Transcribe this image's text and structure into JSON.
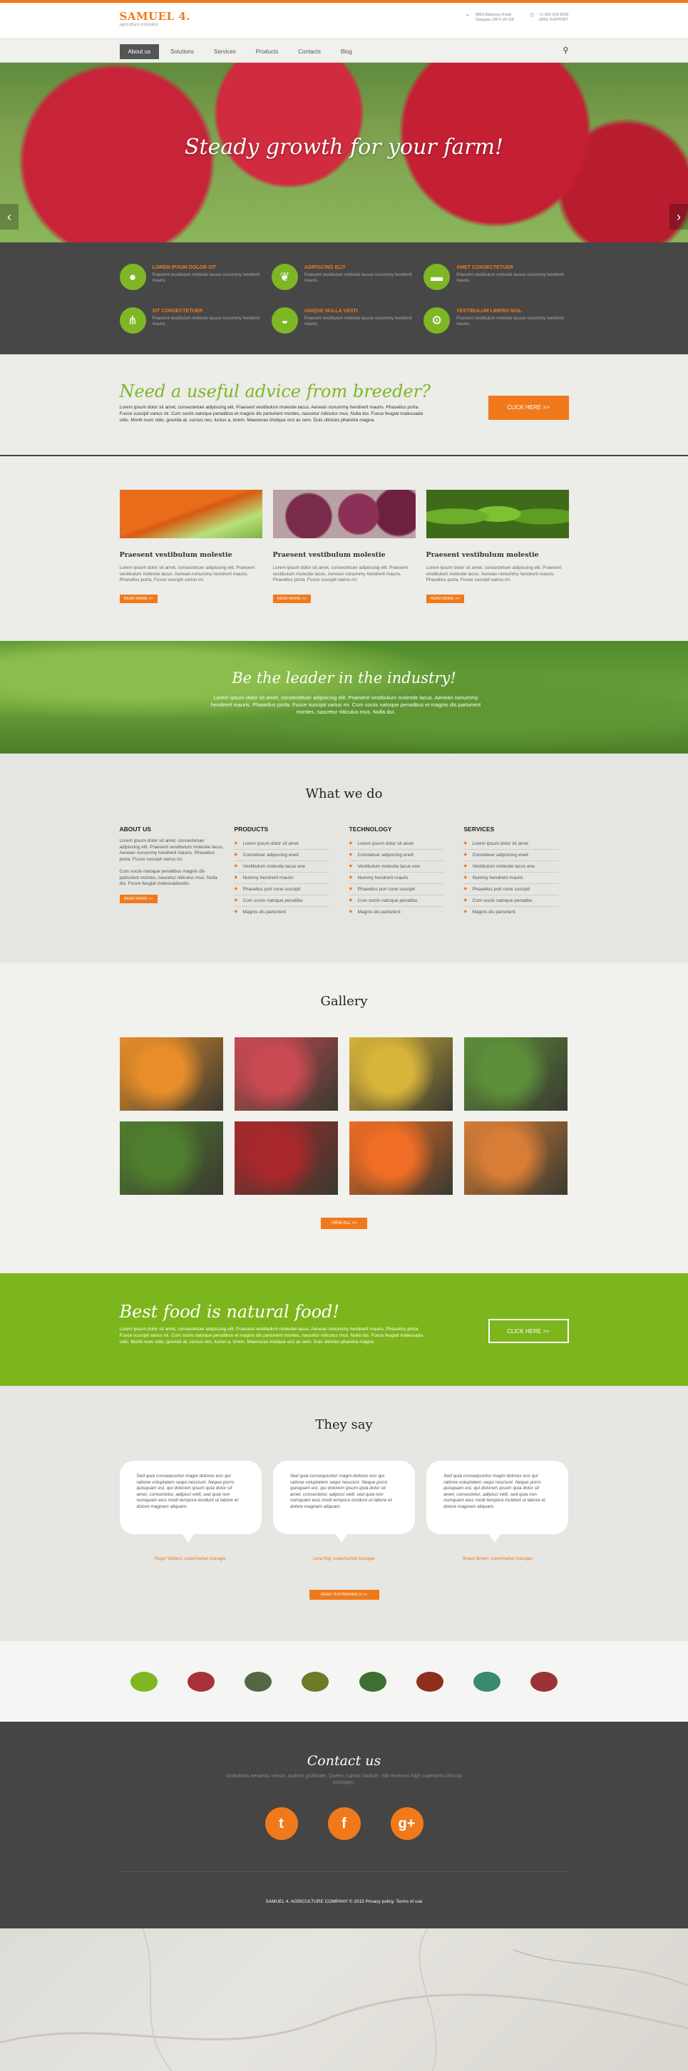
{
  "header": {
    "logo_title": "SAMUEL 4.",
    "logo_subtitle": "agriculture company",
    "address_line1": "9863 Mainway Road",
    "address_line2": "Glasgow, DR 6 9V GB",
    "phone_line1": "+1 800 603 6035",
    "phone_line2": "(800) SUPPORT"
  },
  "nav": {
    "items": [
      {
        "label": "About us"
      },
      {
        "label": "Solutions"
      },
      {
        "label": "Services"
      },
      {
        "label": "Products"
      },
      {
        "label": "Contacts"
      },
      {
        "label": "Blog"
      }
    ]
  },
  "hero": {
    "title": "Steady growth for your farm!"
  },
  "features": [
    {
      "title": "LOREM IPSUM DOLOR SIT",
      "text": "Praesent vestibulum molestie lacuse nonummy hendrerit mauris."
    },
    {
      "title": "ADIPISCING ELIT",
      "text": "Praesent vestibulum molestie lacuse nonummy hendrerit mauris."
    },
    {
      "title": "AMET CONSECTETUER",
      "text": "Praesent vestibulum molestie lacuse nonummy hendrerit mauris."
    },
    {
      "title": "SIT CONSECTETUER",
      "text": "Praesent vestibulum molestie lacuse nonummy hendrerit mauris."
    },
    {
      "title": "UNIQUE NULLA VESTI",
      "text": "Praesent vestibulum molestie lacuse nonummy hendrerit mauris."
    },
    {
      "title": "VESTIBULUM LIBERO NISL",
      "text": "Praesent vestibulum molestie lacuse nonummy hendrerit mauris."
    }
  ],
  "advice": {
    "title": "Need a useful advice from breeder?",
    "text": "Lorem ipsum dolor sit amet, consectetuer adipiscing elit. Praesent vestibulum molestie lacus. Aenean nonummy hendrerit mauris. Phasellus porta. Fusce suscipit varius mi. Cum sociis natoque penatibus et magnis dis parturient montes, nascetur ridiculus mus. Nulla dui. Fusce feugiat malesuada odio. Morbi nunc odio, gravida at, cursus nec, luctus a, lorem. Maecenas tristique orci ac sem. Duis ultricies pharetra magna.",
    "button": "CLICK HERE >>"
  },
  "products": [
    {
      "title": "Praesent vestibulum molestie",
      "text": "Lorem ipsum dolor sit amet, consectetuer adipiscing elit. Praesent vestibulum molestie lacus. Aenean nonummy hendrerit mauris. Phasellus porta. Fusce suscipit varius mi.",
      "button": "READ MORE >>"
    },
    {
      "title": "Praesent vestibulum molestie",
      "text": "Lorem ipsum dolor sit amet, consectetuer adipiscing elit. Praesent vestibulum molestie lacus. Aenean nonummy hendrerit mauris. Phasellus porta. Fusce suscipit varius mi.",
      "button": "READ MORE >>"
    },
    {
      "title": "Praesent vestibulum molestie",
      "text": "Lorem ipsum dolor sit amet, consectetuer adipiscing elit. Praesent vestibulum molestie lacus. Aenean nonummy hendrerit mauris. Phasellus porta. Fusce suscipit varius mi.",
      "button": "READ MORE >>"
    }
  ],
  "leader": {
    "title": "Be the leader in the industry!",
    "text": "Lorem ipsum dolor sit amet, consectetuer adipiscing elit. Praesent vestibulum molestie lacus. Aenean nonummy hendrerit mauris. Phasellus porta. Fusce suscipit varius mi. Cum sociis natoque penatibus et magnis dis parturient montes, nascetur ridiculus mus. Nulla dui."
  },
  "whatwedo": {
    "title": "What we do",
    "about": {
      "heading": "ABOUT US",
      "p1": "Lorem ipsum dolor sit amet, consectetuer adipiscing elit. Praesent vestibulum molestie lacus. Aenean nonummy hendrerit mauris. Phasellus porta. Fusce suscipit varius mi.",
      "p2": "Cum sociis natoque penatibus magnis dis parturient montes, nascetur ridiculus mus. Nulla dui. Fusce feugiat malesuadaodio.",
      "button": "READ MORE >>"
    },
    "columns": [
      {
        "heading": "PRODUCTS",
        "items": [
          "Lorem ipsum dolor sit amet",
          "Constetuer adipiscing eneit",
          "Vestibulum molestie lacus ene",
          "Nummy hendrerit mauris",
          "Phasellus port cone suscipit",
          "Cum sociis natoque penatibu",
          "Magnis dis parturient"
        ]
      },
      {
        "heading": "TECHNOLOGY",
        "items": [
          "Lorem ipsum dolor sit amet",
          "Constetuer adipiscing eneit",
          "Vestibulum molestie lacus ene",
          "Nummy hendrerit mauris",
          "Phasellus port cone suscipit",
          "Cum sociis natoque penatibu",
          "Magnis dis parturient"
        ]
      },
      {
        "heading": "SERVICES",
        "items": [
          "Lorem ipsum dolor sit amet",
          "Constetuer adipiscing eneit",
          "Vestibulum molestie lacus ene",
          "Nummy hendrerit mauris",
          "Phasellus port cone suscipit",
          "Cum sociis natoque penatibu",
          "Magnis dis parturient"
        ]
      }
    ]
  },
  "gallery": {
    "title": "Gallery",
    "button": "VIEW ALL >>",
    "colors": [
      "#e78e2a",
      "#c84a52",
      "#d7b43a",
      "#5d8f3a",
      "#4f7f2e",
      "#a8282b",
      "#ef6d25",
      "#d77d36"
    ]
  },
  "bestfood": {
    "title": "Best food is natural food!",
    "text": "Lorem ipsum dolor sit amet, consectetuer adipiscing elit. Praesent vestibulum molestie lacus. Aenean nonummy hendrerit mauris. Phasellus porta. Fusce suscipit varius mi. Cum sociis natoque penatibus et magnis dis parturient montes, nascetur ridiculus mus. Nulla dui. Fusce feugiat malesuada odio. Morbi nunc odio, gravida at, cursus nec, luctus a, lorem. Maecenas tristique orci ac sem. Duis ultricies pharetra magna.",
    "button": "CLICK HERE >>"
  },
  "testimonials": {
    "title": "They say",
    "items": [
      {
        "quote": "Sed quia consequuntur magni dolores eos qui ratione voluptatem sequi nesciunt. Neque porro quisquam est, qui dolorem ipsum quia dolor sit amet, consectetur, adipisci velit, sed quia non numquam eius modi tempora incidunt ut labore et dolore magnam aliquam.",
        "author": "Roger Walters, supermarket manager"
      },
      {
        "quote": "Sed quia consequuntur magni dolores eos qui ratione voluptatem sequi nesciunt. Neque porro quisquam est, qui dolorem ipsum quia dolor sit amet, consectetur, adipisci velit, sed quia non numquam eius modi tempora incidunt ut labore et dolore magnam aliquam.",
        "author": "Lana Ray, supermarket manager"
      },
      {
        "quote": "Sed quia consequuntur magni dolores eos qui ratione voluptatem sequi nesciunt. Neque porro quisquam est, qui dolorem ipsum quia dolor sit amet, consectetur, adipisci velit, sed quia non numquam eius modi tempora incidunt ut labore et dolore magnam aliquam.",
        "author": "Shawn Brown, supermarket manager"
      }
    ],
    "button": "READ TESTIMONIALS >>"
  },
  "partners": {
    "colors": [
      "#7eb624",
      "#a83239",
      "#556644",
      "#6d7a26",
      "#3d6e32",
      "#8e2e1e",
      "#3a8a6e",
      "#9b3236"
    ]
  },
  "contact": {
    "title": "Contact us",
    "text": "Gratuitous aenaeas vesuis, audium gluttinate, Queen nuptus stadium. Ste tenemus high superianti cloccup estringen.",
    "social": [
      "t",
      "f",
      "g+"
    ],
    "copyright": "SAMUEL 4. AGRICULTURE COMPANY © 2015 Privacy policy. Terms of use"
  },
  "colors": {
    "accent": "#f07a1b",
    "green": "#7eb624",
    "dark": "#474747"
  }
}
